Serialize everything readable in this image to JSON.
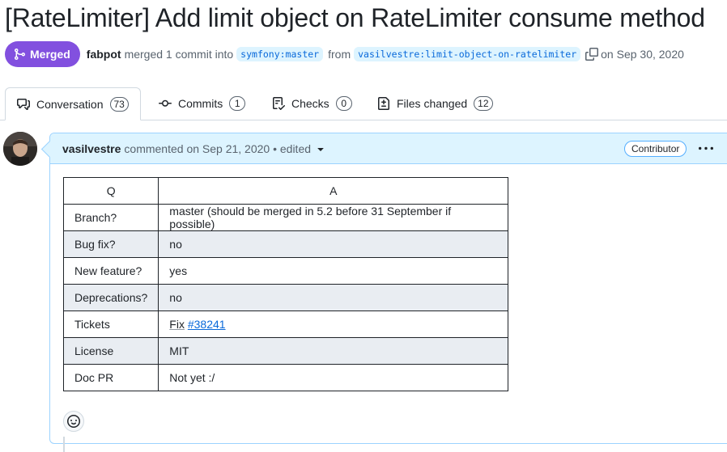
{
  "pr": {
    "title": "[RateLimiter] Add limit object on RateLimiter consume method",
    "status_label": "Merged",
    "author": "fabpot",
    "merge_text": "merged 1 commit into",
    "base_branch": "symfony:master",
    "from_text": "from",
    "head_branch": "vasilvestre:limit-object-on-ratelimiter",
    "date_text": "on Sep 30, 2020"
  },
  "tabs": [
    {
      "label": "Conversation",
      "count": "73",
      "icon": "comment-discussion-icon",
      "active": true
    },
    {
      "label": "Commits",
      "count": "1",
      "icon": "git-commit-icon",
      "active": false
    },
    {
      "label": "Checks",
      "count": "0",
      "icon": "checklist-icon",
      "active": false
    },
    {
      "label": "Files changed",
      "count": "12",
      "icon": "file-diff-icon",
      "active": false
    }
  ],
  "comment": {
    "author": "vasilvestre",
    "meta": "commented on Sep 21, 2020 • edited",
    "role_badge": "Contributor",
    "table": {
      "headers": [
        "Q",
        "A"
      ],
      "rows": [
        {
          "q": "Branch?",
          "a": "master (should be merged in 5.2 before 31 September if possible)"
        },
        {
          "q": "Bug fix?",
          "a": "no"
        },
        {
          "q": "New feature?",
          "a": "yes"
        },
        {
          "q": "Deprecations?",
          "a": "no"
        },
        {
          "q": "Tickets",
          "a_prefix": "Fix",
          "a_link": "#38241"
        },
        {
          "q": "License",
          "a": "MIT"
        },
        {
          "q": "Doc PR",
          "a": "Not yet :/"
        }
      ]
    }
  },
  "colors": {
    "merged": "#8250df",
    "link": "#0969da",
    "header_bg": "#ddf4ff",
    "row_alt": "#e9edf2"
  }
}
